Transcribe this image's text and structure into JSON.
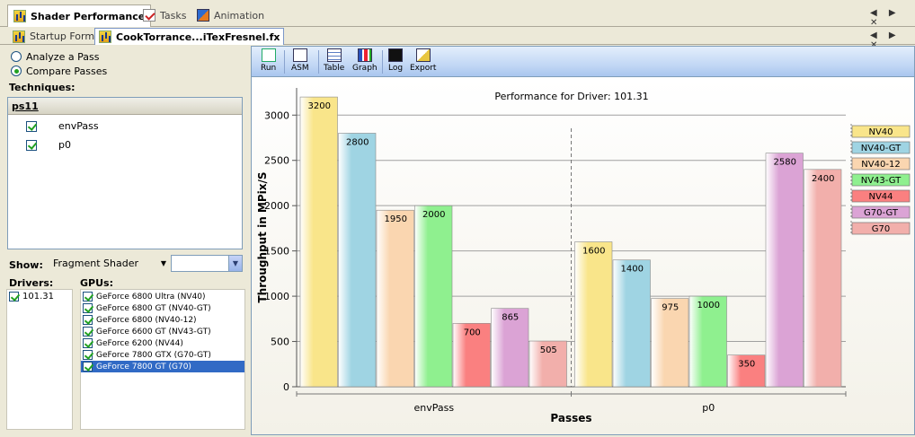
{
  "top_tabs": [
    {
      "label": "Shader Performance",
      "active": true
    },
    {
      "label": "Tasks",
      "active": false
    },
    {
      "label": "Animation",
      "active": false
    }
  ],
  "sub_tabs": [
    {
      "label": "Startup Form",
      "active": false
    },
    {
      "label": "CookTorrance...iTexFresnel.fx",
      "active": true
    }
  ],
  "nav_glyphs": "◀ ▶ ✕",
  "left": {
    "mode_options": [
      {
        "label": "Analyze a Pass",
        "selected": false
      },
      {
        "label": "Compare Passes",
        "selected": true
      }
    ],
    "techniques_label": "Techniques:",
    "technique": {
      "name": "ps11",
      "passes": [
        {
          "label": "envPass",
          "checked": true
        },
        {
          "label": "p0",
          "checked": true
        }
      ]
    },
    "show_label": "Show:",
    "show_value": "Fragment Shader",
    "drivers_label": "Drivers:",
    "drivers": [
      {
        "label": "101.31",
        "checked": true
      }
    ],
    "gpus_label": "GPUs:",
    "gpus": [
      {
        "label": "GeForce 6800 Ultra (NV40)",
        "checked": true,
        "selected": false
      },
      {
        "label": "GeForce 6800 GT (NV40-GT)",
        "checked": true,
        "selected": false
      },
      {
        "label": "GeForce 6800 (NV40-12)",
        "checked": true,
        "selected": false
      },
      {
        "label": "GeForce 6600 GT (NV43-GT)",
        "checked": true,
        "selected": false
      },
      {
        "label": "GeForce 6200 (NV44)",
        "checked": true,
        "selected": false
      },
      {
        "label": "GeForce 7800 GTX (G70-GT)",
        "checked": true,
        "selected": false
      },
      {
        "label": "GeForce 7800 GT (G70)",
        "checked": true,
        "selected": true
      }
    ]
  },
  "toolbar": {
    "buttons": [
      {
        "label": "Run",
        "icon": "run-icon"
      },
      {
        "label": "ASM",
        "icon": "asm-icon"
      },
      {
        "label": "Table",
        "icon": "table-icon"
      },
      {
        "label": "Graph",
        "icon": "graph-icon"
      },
      {
        "label": "Log",
        "icon": "log-icon"
      },
      {
        "label": "Export",
        "icon": "export-icon"
      }
    ]
  },
  "colors": {
    "NV40": "#f9e58a",
    "NV40-GT": "#9fd4e3",
    "NV40-12": "#fad6b0",
    "NV43-GT": "#8ff08f",
    "NV44": "#fa8080",
    "G70-GT": "#dba3d5",
    "G70": "#f2afab"
  },
  "chart_data": {
    "type": "bar",
    "title": "Performance for Driver: 101.31",
    "xlabel": "Passes",
    "ylabel": "Throughput in MPix/S",
    "ylim": [
      0,
      3300
    ],
    "yticks": [
      0,
      500,
      1000,
      1500,
      2000,
      2500,
      3000
    ],
    "grid": true,
    "legend_position": "right",
    "categories": [
      "envPass",
      "p0"
    ],
    "series": [
      {
        "name": "NV40",
        "values": [
          3200,
          1600
        ]
      },
      {
        "name": "NV40-GT",
        "values": [
          2800,
          1400
        ]
      },
      {
        "name": "NV40-12",
        "values": [
          1950,
          975
        ]
      },
      {
        "name": "NV43-GT",
        "values": [
          2000,
          1000
        ]
      },
      {
        "name": "NV44",
        "values": [
          700,
          350
        ]
      },
      {
        "name": "G70-GT",
        "values": [
          865,
          2580
        ]
      },
      {
        "name": "G70",
        "values": [
          505,
          2400
        ]
      }
    ]
  }
}
